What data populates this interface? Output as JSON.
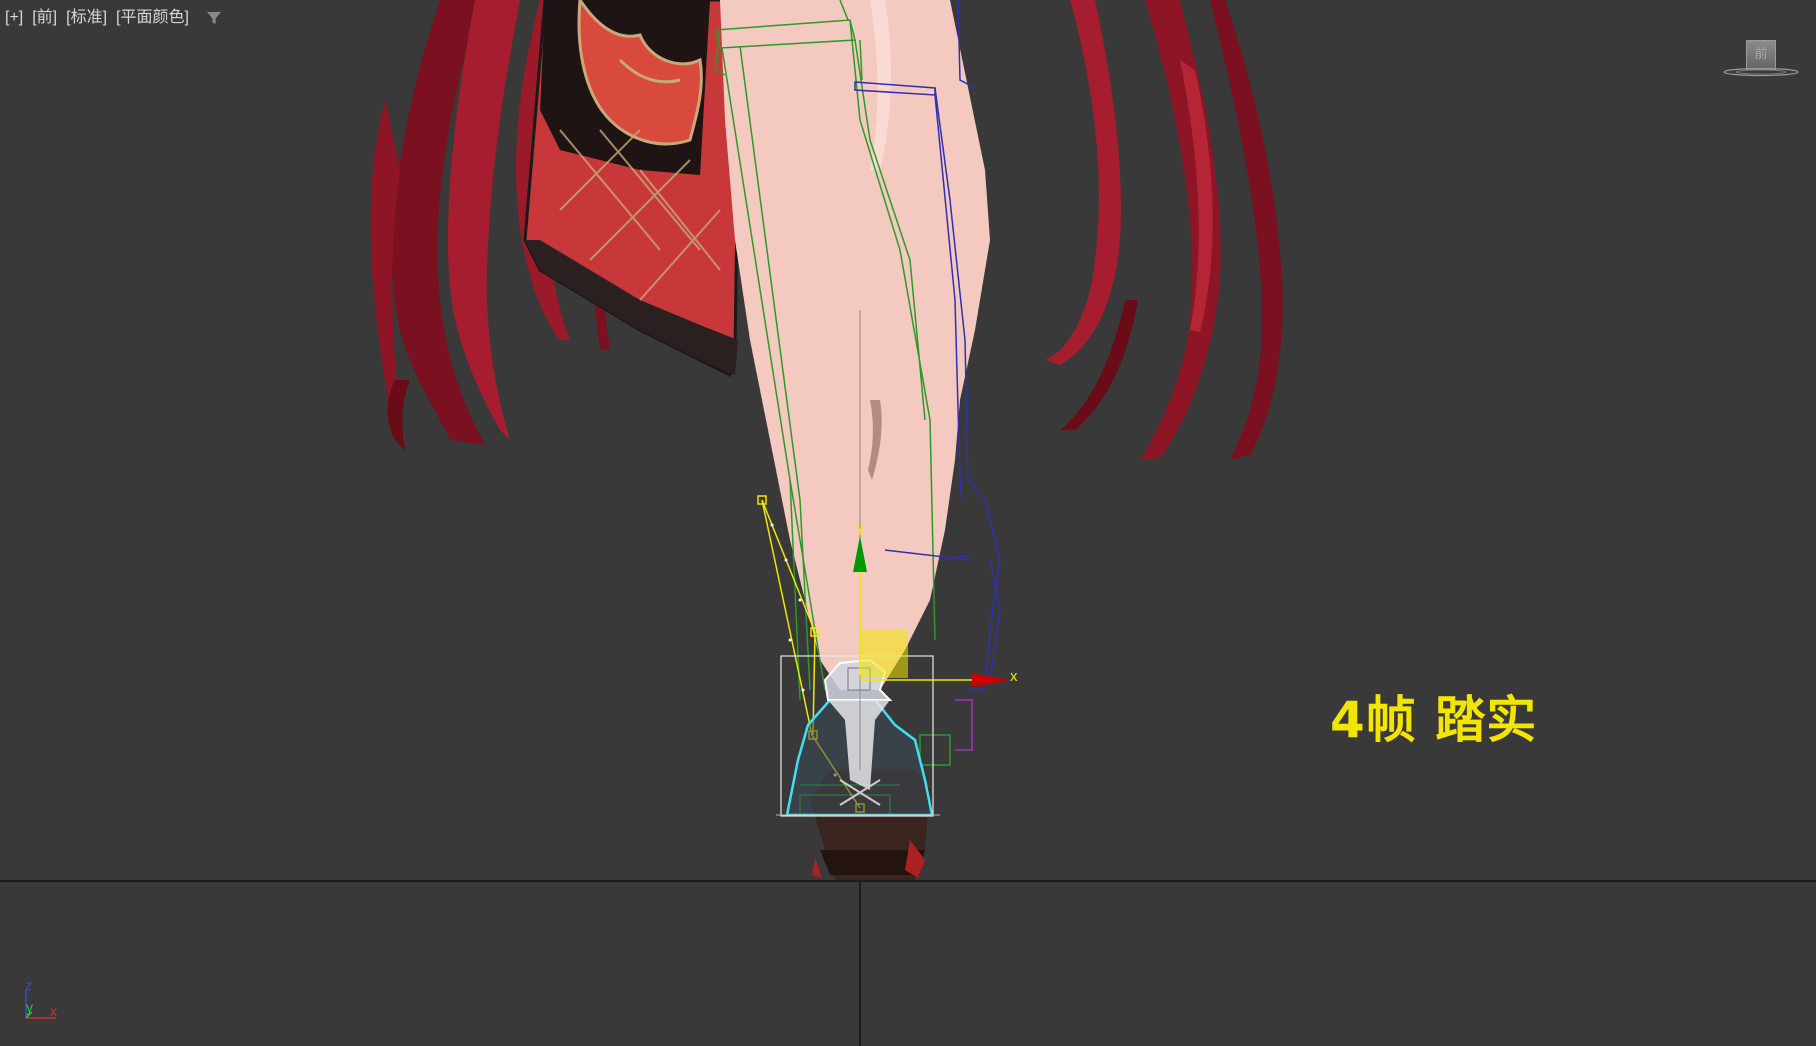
{
  "viewport": {
    "menu_plus": "[+]",
    "menu_view": "[前]",
    "menu_shading": "[标准]",
    "menu_style": "[平面颜色]",
    "filter_icon": "filter-icon"
  },
  "viewcube": {
    "face_label": "前"
  },
  "gizmo": {
    "x_label": "x",
    "y_label": "y"
  },
  "axis_tripod": {
    "z_label": "z",
    "y_label": "y",
    "x_label": "x"
  },
  "caption": "4帧 踏实",
  "colors": {
    "background": "#393939",
    "caption": "#f2e600",
    "gizmo_x": "#cc0000",
    "gizmo_y": "#009900",
    "foot_control": "#40e0f0",
    "ik_chain": "#f2e600",
    "bone_green": "#2a9a2a",
    "bone_blue": "#2a2aaa"
  }
}
